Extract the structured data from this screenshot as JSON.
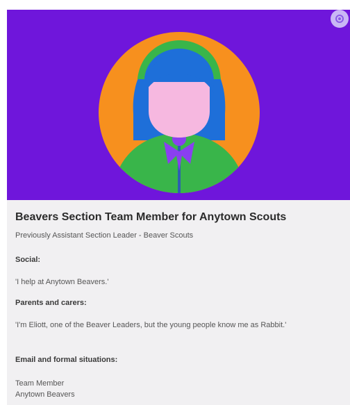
{
  "profile": {
    "title": "Beavers Section Team Member for Anytown Scouts",
    "subtitle": "Previously Assistant Section Leader - Beaver Scouts",
    "sections": [
      {
        "label": "Social:",
        "text": "'I help at Anytown Beavers.'"
      },
      {
        "label": "Parents and carers:",
        "text": "'I'm Eliott, one of the Beaver Leaders, but the young people know me as Rabbit.'"
      },
      {
        "label": "Email and formal situations:",
        "line1": "Team Member",
        "line2": "Anytown Beavers"
      }
    ]
  },
  "colors": {
    "hero_bg": "#6f16db",
    "circle": "#f7901e",
    "hair": "#1e6fd9",
    "headband": "#39b54a",
    "face": "#f6b8e0",
    "body": "#39b54a",
    "scarf": "#8a3ff0"
  },
  "icons": {
    "corner": "settings-icon"
  }
}
